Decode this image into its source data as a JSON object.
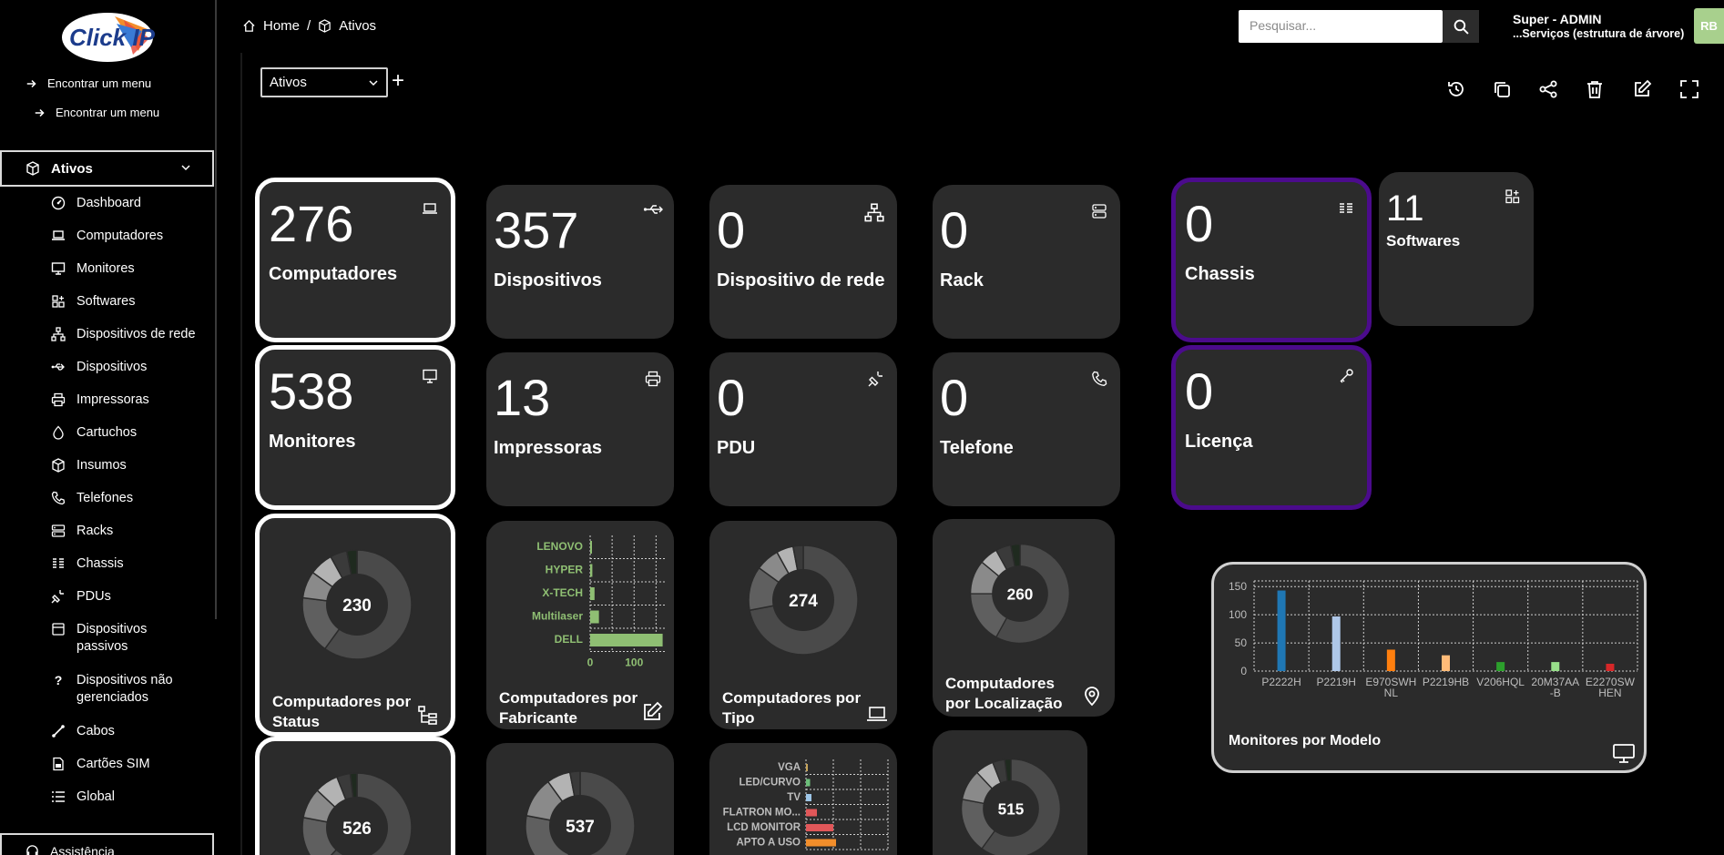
{
  "header": {
    "breadcrumb": [
      "Home",
      "Ativos"
    ],
    "search_placeholder": "Pesquisar...",
    "user_name": "Super - ADMIN",
    "user_entity": "...Serviços (estrutura de árvore)",
    "avatar_initials": "RB"
  },
  "sidebar": {
    "logo_text": "Click IP",
    "find_menu_1": "Encontrar um menu",
    "find_menu_2": "Encontrar um menu",
    "section_ativos": "Ativos",
    "items": [
      {
        "label": "Dashboard",
        "icon": "dashboard-icon"
      },
      {
        "label": "Computadores",
        "icon": "laptop-icon"
      },
      {
        "label": "Monitores",
        "icon": "monitor-icon"
      },
      {
        "label": "Softwares",
        "icon": "apps-icon"
      },
      {
        "label": "Dispositivos de rede",
        "icon": "network-icon"
      },
      {
        "label": "Dispositivos",
        "icon": "usb-icon"
      },
      {
        "label": "Impressoras",
        "icon": "printer-icon"
      },
      {
        "label": "Cartuchos",
        "icon": "ink-drop-icon"
      },
      {
        "label": "Insumos",
        "icon": "box-icon"
      },
      {
        "label": "Telefones",
        "icon": "phone-icon"
      },
      {
        "label": "Racks",
        "icon": "server-icon"
      },
      {
        "label": "Chassis",
        "icon": "chassis-icon"
      },
      {
        "label": "PDUs",
        "icon": "plug-icon"
      },
      {
        "label": "Dispositivos passivos",
        "icon": "passive-device-icon"
      },
      {
        "label": "Dispositivos não gerenciados",
        "icon": "question-icon"
      },
      {
        "label": "Cabos",
        "icon": "cable-icon"
      },
      {
        "label": "Cartões SIM",
        "icon": "sim-card-icon"
      },
      {
        "label": "Global",
        "icon": "list-icon"
      }
    ],
    "section_assist": "Assistência"
  },
  "dashboard": {
    "selected": "Ativos",
    "add_label": "+",
    "cards": [
      {
        "value": "276",
        "label": "Computadores",
        "icon": "laptop-icon"
      },
      {
        "value": "357",
        "label": "Dispositivos",
        "icon": "usb-icon"
      },
      {
        "value": "0",
        "label": "Dispositivo de rede",
        "icon": "network-icon"
      },
      {
        "value": "0",
        "label": "Rack",
        "icon": "server-icon"
      },
      {
        "value": "0",
        "label": "Chassis",
        "icon": "chassis-icon"
      },
      {
        "value": "11",
        "label": "Softwares",
        "icon": "apps-icon"
      },
      {
        "value": "538",
        "label": "Monitores",
        "icon": "monitor-icon"
      },
      {
        "value": "13",
        "label": "Impressoras",
        "icon": "printer-icon"
      },
      {
        "value": "0",
        "label": "PDU",
        "icon": "plug-icon"
      },
      {
        "value": "0",
        "label": "Telefone",
        "icon": "phone-icon"
      },
      {
        "value": "0",
        "label": "Licença",
        "icon": "key-icon"
      }
    ],
    "donuts": [
      {
        "total": "230",
        "title": "Computadores por Status",
        "icon": "tree-icon"
      },
      {
        "total": "274",
        "title": "Computadores por Tipo",
        "icon": "laptop-icon"
      },
      {
        "total": "260",
        "title": "Computadores por Localização",
        "icon": "location-icon"
      },
      {
        "total": "526",
        "title": "",
        "icon": ""
      },
      {
        "total": "537",
        "title": "",
        "icon": ""
      },
      {
        "total": "515",
        "title": "",
        "icon": ""
      }
    ],
    "fabricante_title": "Computadores por Fabricante",
    "fabricante_icon": "edit-icon"
  },
  "chart_data": [
    {
      "type": "bar",
      "orientation": "horizontal",
      "title": "Computadores por Fabricante",
      "categories": [
        "LENOVO",
        "HYPER",
        "X-TECH",
        "Multilaser",
        "DELL"
      ],
      "values": [
        3,
        5,
        10,
        20,
        165
      ],
      "xticks": [
        "0",
        "100"
      ],
      "xlim": [
        0,
        170
      ],
      "color": "#8fbf73",
      "grid": true
    },
    {
      "type": "bar",
      "orientation": "horizontal",
      "title": "",
      "categories": [
        "VGA",
        "LED/CURVO",
        "TV",
        "FLATRON MO...",
        "LCD MONITOR",
        "APTO A USO"
      ],
      "values": [
        1,
        3,
        4,
        8,
        20,
        22
      ],
      "colors": [
        "#c8a55a",
        "#6cbf7a",
        "#9ec6e8",
        "#e15759",
        "#e15759",
        "#f28e2b"
      ],
      "grid": true
    },
    {
      "type": "bar",
      "title": "Monitores por Modelo",
      "categories": [
        "P2222H",
        "P2219H",
        "E970SWHNL",
        "P2219HB",
        "V206HQL",
        "20M37AA-B",
        "E2270SWHEN"
      ],
      "category_labels": [
        [
          "P2222H"
        ],
        [
          "P2219H"
        ],
        [
          "E970SWH",
          "NL"
        ],
        [
          "P2219HB"
        ],
        [
          "V206HQL"
        ],
        [
          "20M37AA",
          "-B"
        ],
        [
          "E2270SW",
          "HEN"
        ]
      ],
      "values": [
        143,
        97,
        38,
        28,
        16,
        16,
        13
      ],
      "colors": [
        "#1f77b4",
        "#aec7e8",
        "#ff7f0e",
        "#ffbb78",
        "#2ca02c",
        "#98df8a",
        "#d62728"
      ],
      "yticks": [
        0,
        50,
        100,
        150
      ],
      "ylim": [
        0,
        160
      ],
      "grid": true
    }
  ]
}
